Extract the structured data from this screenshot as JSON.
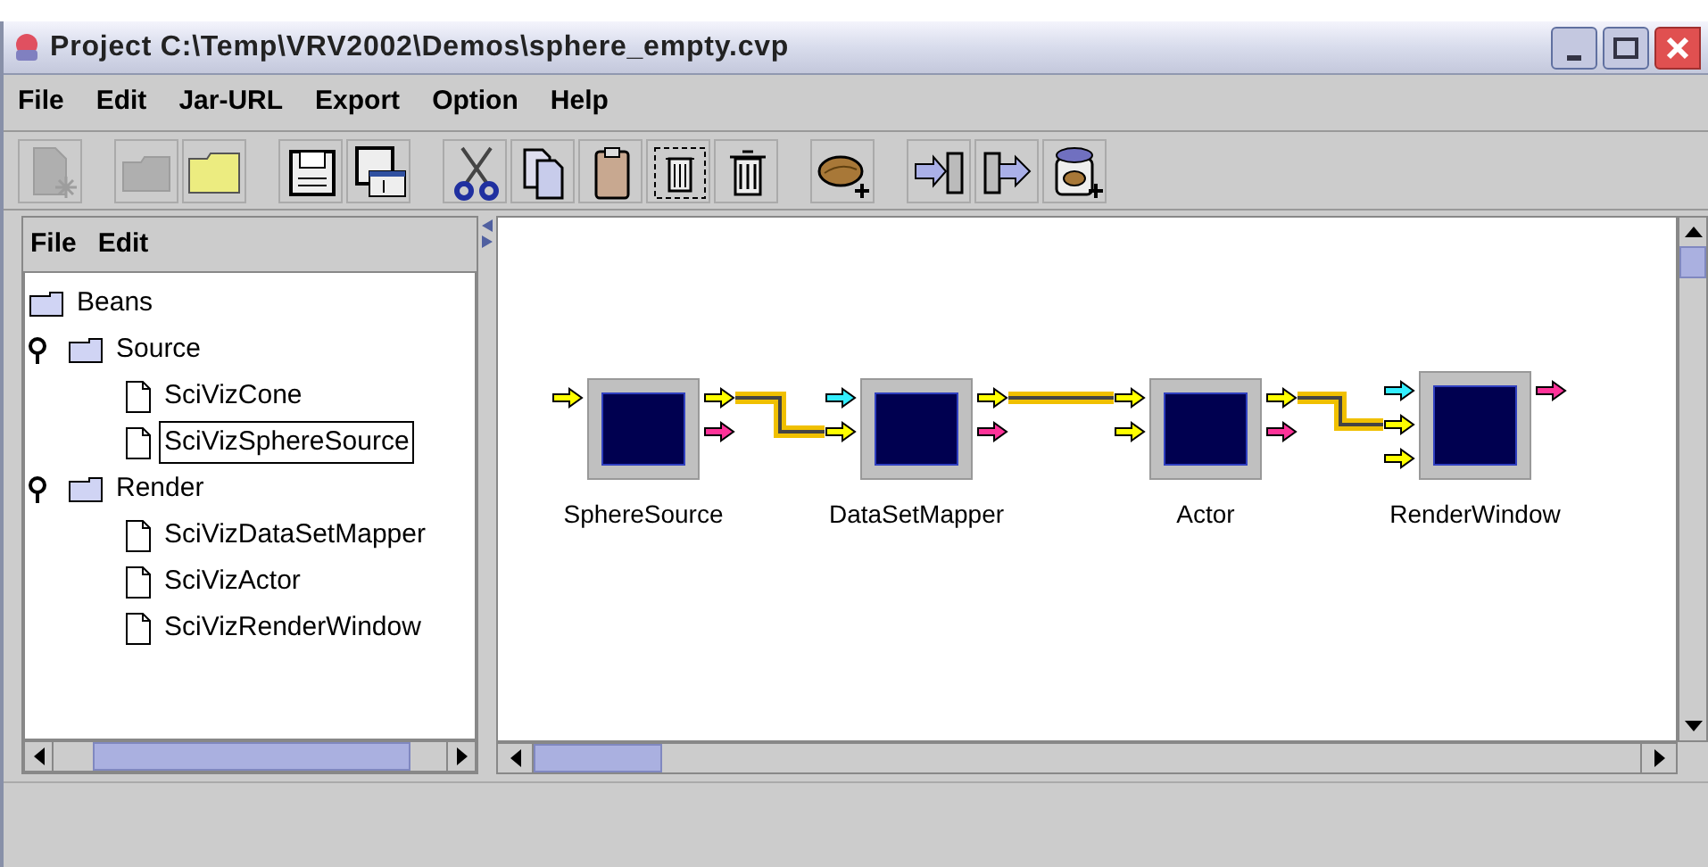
{
  "window": {
    "title": "Project C:\\Temp\\VRV2002\\Demos\\sphere_empty.cvp"
  },
  "menu": [
    "File",
    "Edit",
    "Jar-URL",
    "Export",
    "Option",
    "Help"
  ],
  "toolbar": [
    [
      {
        "disabled": true
      }
    ],
    [
      {
        "disabled": true
      },
      {
        "disabled": false
      }
    ],
    [
      {
        "disabled": false
      },
      {
        "disabled": false
      }
    ],
    [
      {
        "disabled": false
      },
      {
        "disabled": false
      },
      {
        "disabled": false
      },
      {
        "disabled": false
      },
      {
        "disabled": false
      }
    ],
    [
      {
        "disabled": false
      }
    ],
    [
      {
        "disabled": false
      },
      {
        "disabled": false
      },
      {
        "disabled": false
      }
    ]
  ],
  "side_menu": [
    "File",
    "Edit"
  ],
  "tree": [
    {
      "label": "Beans",
      "kind": "folder",
      "selected": false,
      "children": [
        {
          "label": "Source",
          "kind": "folder",
          "expanded": true,
          "selected": false,
          "children": [
            {
              "label": "SciVizCone",
              "kind": "file",
              "selected": false
            },
            {
              "label": "SciVizSphereSource",
              "kind": "file",
              "selected": true
            }
          ]
        },
        {
          "label": "Render",
          "kind": "folder",
          "expanded": true,
          "selected": false,
          "children": [
            {
              "label": "SciVizDataSetMapper",
              "kind": "file",
              "selected": false
            },
            {
              "label": "SciVizActor",
              "kind": "file",
              "selected": false
            },
            {
              "label": "SciVizRenderWindow",
              "kind": "file",
              "selected": false
            }
          ]
        }
      ]
    }
  ],
  "nodes": [
    {
      "label": "SphereSource",
      "inputs": [
        {
          "color": "#ffff00"
        }
      ],
      "outputs": [
        {
          "color": "#ffff00",
          "linked": true
        },
        {
          "color": "#ff3399",
          "linked": false
        }
      ]
    },
    {
      "label": "DataSetMapper",
      "inputs": [
        {
          "color": "#33eeff"
        },
        {
          "color": "#ffff00"
        }
      ],
      "outputs": [
        {
          "color": "#ffff00",
          "linked": true
        },
        {
          "color": "#ff3399",
          "linked": false
        }
      ]
    },
    {
      "label": "Actor",
      "inputs": [
        {
          "color": "#ffff00"
        },
        {
          "color": "#ffff00"
        }
      ],
      "outputs": [
        {
          "color": "#ffff00",
          "linked": true
        },
        {
          "color": "#ff3399",
          "linked": false
        }
      ]
    },
    {
      "label": "RenderWindow",
      "inputs": [
        {
          "color": "#33eeff"
        },
        {
          "color": "#ffff00"
        },
        {
          "color": "#ffff00"
        }
      ],
      "outputs": [
        {
          "color": "#ff3399"
        }
      ]
    }
  ]
}
